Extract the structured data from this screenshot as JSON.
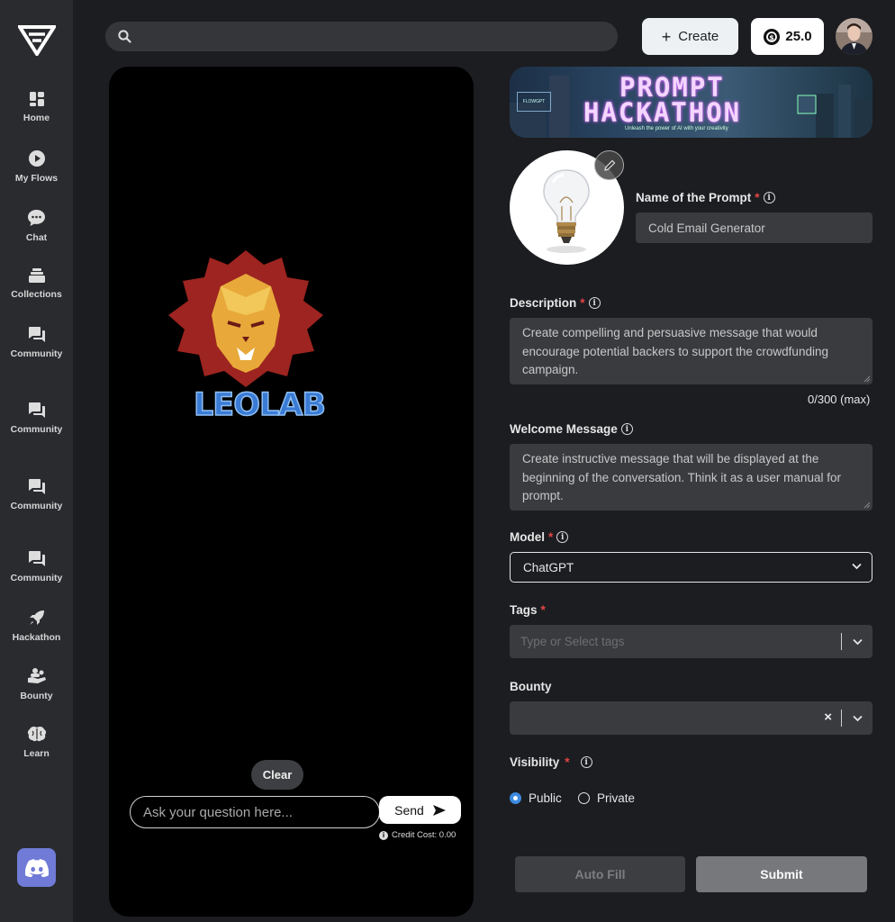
{
  "sidebar": {
    "items": [
      {
        "label": "Home",
        "icon": "home-icon"
      },
      {
        "label": "My Flows",
        "icon": "play-icon"
      },
      {
        "label": "Chat",
        "icon": "chat-bubble-icon"
      },
      {
        "label": "Collections",
        "icon": "stack-icon"
      },
      {
        "label": "Community",
        "icon": "community-icon"
      },
      {
        "label": "Community",
        "icon": "community-icon"
      },
      {
        "label": "Community",
        "icon": "community-icon"
      },
      {
        "label": "Community",
        "icon": "community-icon"
      },
      {
        "label": "Hackathon",
        "icon": "rocket-icon"
      },
      {
        "label": "Bounty",
        "icon": "bounty-icon"
      },
      {
        "label": "Learn",
        "icon": "brain-icon"
      }
    ]
  },
  "header": {
    "search_placeholder": "",
    "create_label": "Create",
    "credits": "25.0"
  },
  "preview": {
    "logo_text": "LEOLAB",
    "clear_label": "Clear",
    "ask_placeholder": "Ask your question here...",
    "send_label": "Send",
    "credit_cost": "Credit Cost: 0.00"
  },
  "banner": {
    "line1": "PROMPT",
    "line2": "HACKATHON",
    "brand": "FLOWGPT",
    "tagline": "Unleash the power of AI with your creativity"
  },
  "form": {
    "name_label": "Name of the Prompt",
    "name_placeholder": "Cold Email Generator",
    "description_label": "Description",
    "description_placeholder": "Create compelling and persuasive message that would encourage potential backers to support the crowdfunding campaign.",
    "description_counter": "0/300 (max)",
    "welcome_label": "Welcome Message",
    "welcome_placeholder": "Create instructive message that will be displayed at the beginning of the conversation. Think it as a user manual for prompt.",
    "model_label": "Model",
    "model_value": "ChatGPT",
    "tags_label": "Tags",
    "tags_placeholder": "Type or Select tags",
    "bounty_label": "Bounty",
    "visibility_label": "Visibility",
    "visibility_options": [
      "Public",
      "Private"
    ],
    "visibility_selected": "Public",
    "autofill_label": "Auto Fill",
    "submit_label": "Submit"
  },
  "colors": {
    "background": "#1c1d21",
    "sidebar": "#2a2b2f",
    "field": "#3a3b3f",
    "accent_radio": "#3c8be0",
    "required": "#e64545",
    "discord": "#6f7bd6"
  }
}
